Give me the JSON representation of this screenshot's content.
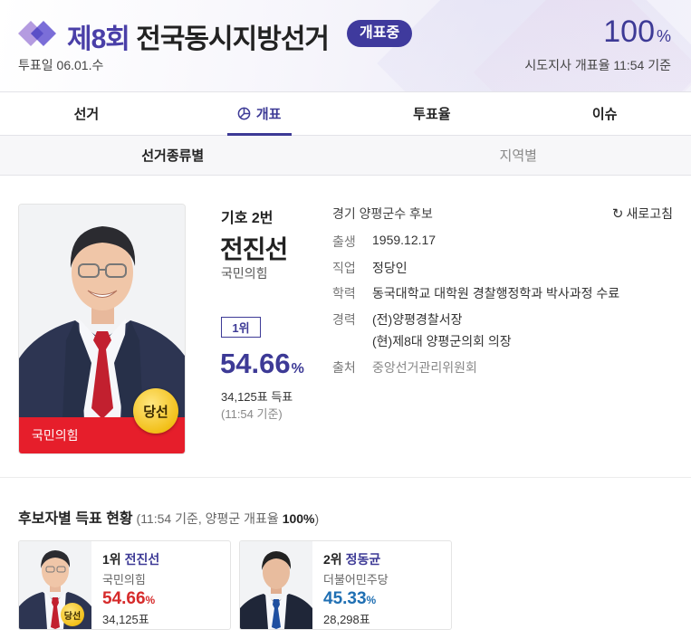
{
  "header": {
    "title_num": "제8회",
    "title_rest": " 전국동시지방선거",
    "live_badge": "개표중",
    "vote_date": "투표일 06.01.수",
    "progress_value": "100",
    "progress_unit": "%",
    "count_info": "시도지사 개표율 11:54 기준"
  },
  "tabs": [
    {
      "label": "선거"
    },
    {
      "label": "개표",
      "icon": "pie-chart-icon",
      "active": true
    },
    {
      "label": "투표율"
    },
    {
      "label": "이슈"
    }
  ],
  "subtabs": [
    {
      "label": "선거종류별",
      "active": true
    },
    {
      "label": "지역별"
    }
  ],
  "candidate": {
    "number": "기호 2번",
    "name": "전진선",
    "party": "국민의힘",
    "party_strip": "국민의힘",
    "elected_badge": "당선",
    "rank": "1위",
    "percent": "54.66",
    "percent_unit": "%",
    "votes": "34,125표 득표",
    "time": "(11:54 기준)",
    "region": "경기 양평군수 후보",
    "refresh_label": "새로고침",
    "birth_label": "출생",
    "birth": "1959.12.17",
    "job_label": "직업",
    "job": "정당인",
    "edu_label": "학력",
    "edu": "동국대학교 대학원 경찰행정학과 박사과정 수료",
    "career_label": "경력",
    "career": [
      "(전)양평경찰서장",
      "(현)제8대 양평군의회 의장"
    ],
    "source_label": "출처",
    "source": "중앙선거관리위원회"
  },
  "section": {
    "title": "후보자별 득표 현황",
    "sub_prefix": " (11:54 기준, 양평군 개표율 ",
    "sub_value": "100%",
    "sub_suffix": ")"
  },
  "candidates": [
    {
      "rank": "1위",
      "name": "전진선",
      "party": "국민의힘",
      "percent": "54.66",
      "unit": "%",
      "votes": "34,125표",
      "badge": "당선",
      "color": "#d62a2a"
    },
    {
      "rank": "2위",
      "name": "정동균",
      "party": "더불어민주당",
      "percent": "45.33",
      "unit": "%",
      "votes": "28,298표",
      "color": "#1f6fb3"
    }
  ],
  "colors": {
    "accent": "#3d3a96",
    "ppp_red": "#e61e2b",
    "dp_blue": "#1f6fb3"
  }
}
